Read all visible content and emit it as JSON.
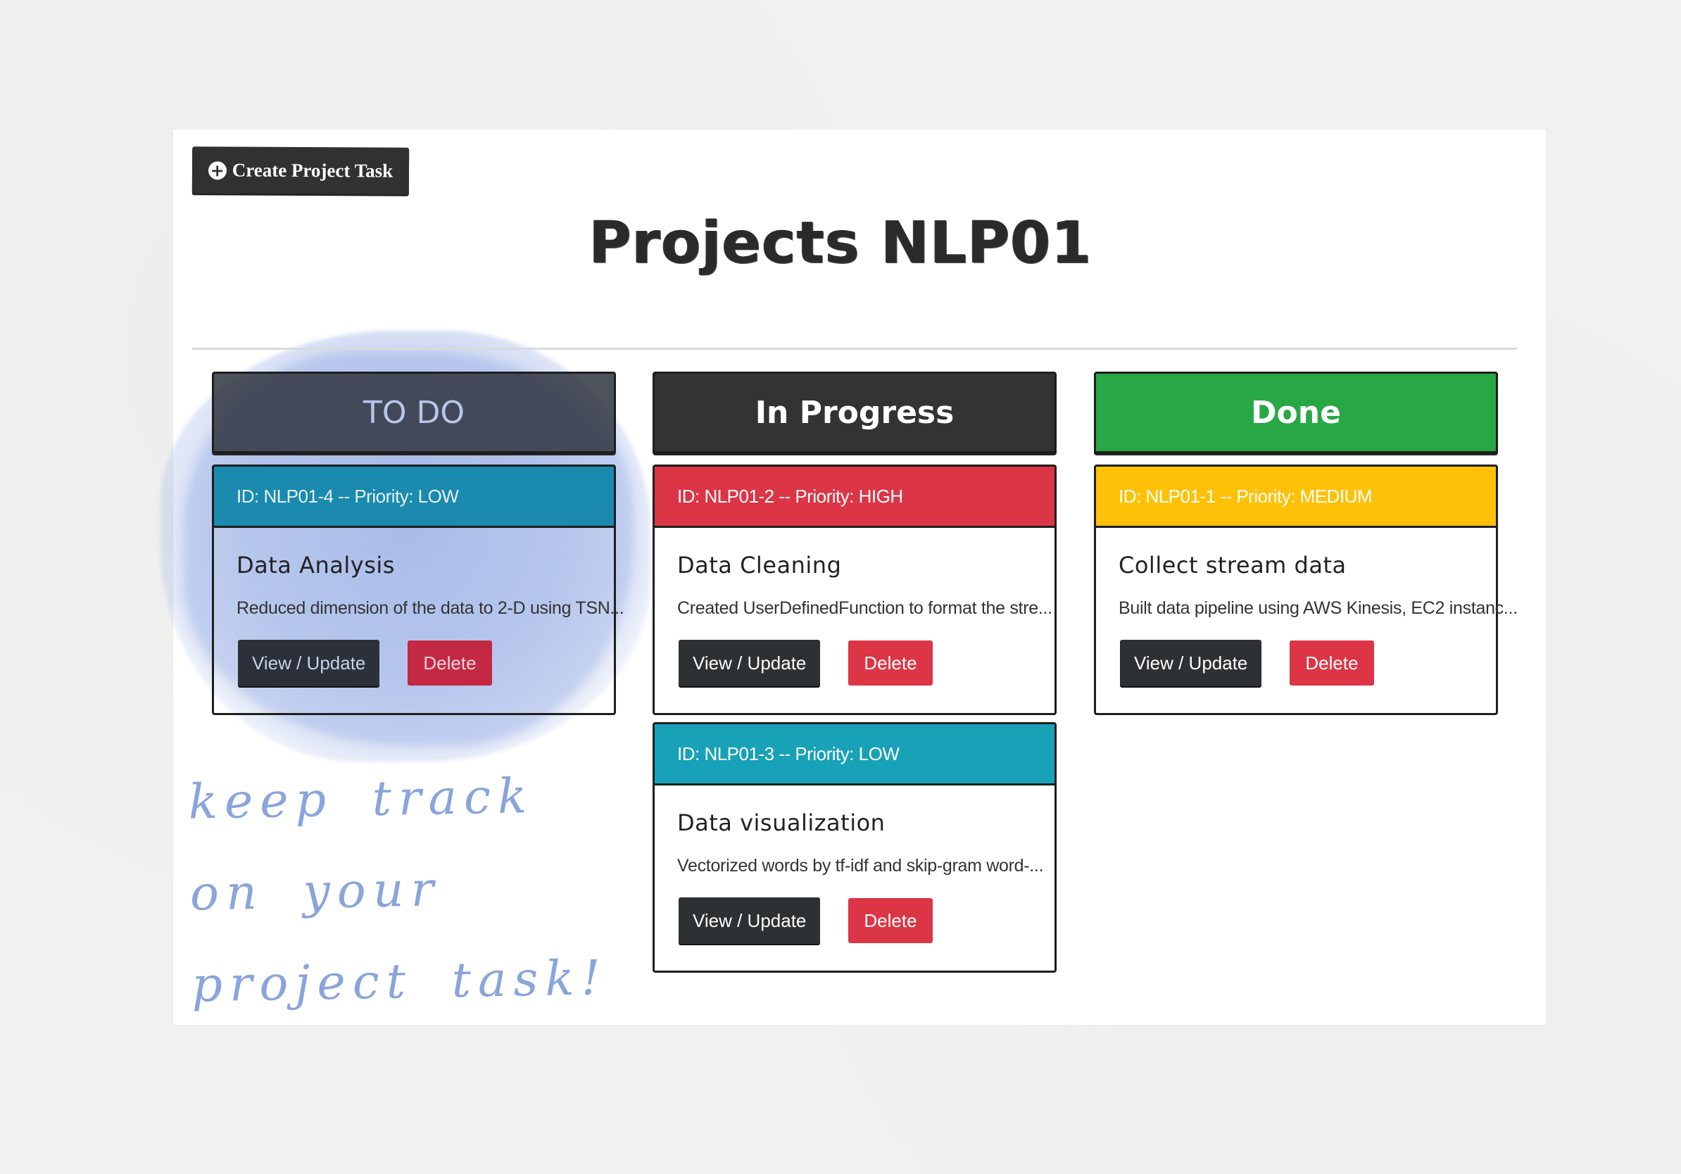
{
  "toolbar": {
    "create_label": "Create Project Task",
    "create_icon": "plus-circle-icon"
  },
  "page": {
    "title": "Projects NLP01"
  },
  "columns": [
    {
      "title": "TO DO",
      "color": "#343a40",
      "tasks": [
        {
          "header": "ID: NLP01-4 -- Priority: LOW",
          "priority_color": "#17a2b8",
          "title": "Data Analysis",
          "description": "Reduced dimension of the data to 2-D using TSN...",
          "view_label": "View / Update",
          "delete_label": "Delete"
        }
      ]
    },
    {
      "title": "In Progress",
      "color": "#333333",
      "tasks": [
        {
          "header": "ID: NLP01-2 -- Priority: HIGH",
          "priority_color": "#dc3545",
          "title": "Data Cleaning",
          "description": "Created UserDefinedFunction to format the stre...",
          "view_label": "View / Update",
          "delete_label": "Delete"
        },
        {
          "header": "ID: NLP01-3 -- Priority: LOW",
          "priority_color": "#17a2b8",
          "title": "Data visualization",
          "description": "Vectorized words by tf-idf and skip-gram word-...",
          "view_label": "View / Update",
          "delete_label": "Delete"
        }
      ]
    },
    {
      "title": "Done",
      "color": "#28a745",
      "tasks": [
        {
          "header": "ID: NLP01-1 -- Priority: MEDIUM",
          "priority_color": "#ffc107",
          "title": "Collect stream data",
          "description": "Built data pipeline using AWS Kinesis, EC2 instanc...",
          "view_label": "View / Update",
          "delete_label": "Delete"
        }
      ]
    }
  ],
  "annotation": {
    "line1": "keep track on your",
    "line2": "project task!"
  }
}
